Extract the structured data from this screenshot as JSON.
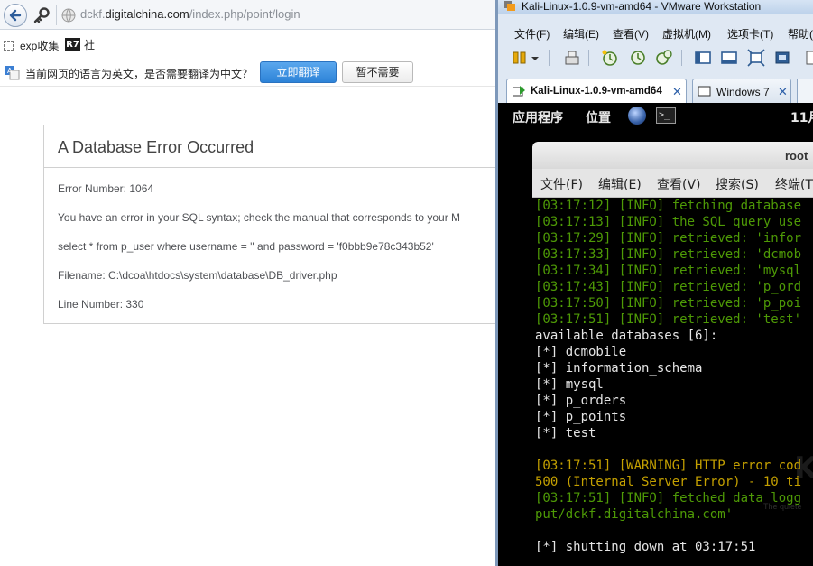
{
  "browser": {
    "url_prefix": "dckf.",
    "url_domain": "digitalchina.com",
    "url_path": "/index.php/point/login",
    "bookmarks": [
      {
        "label": "exp收集"
      },
      {
        "label": "社",
        "icon_text": "R7"
      }
    ],
    "translate_prompt": "当前网页的语言为英文，是否需要翻译为中文？",
    "translate_button": "立即翻译",
    "not_now_button": "暂不需要"
  },
  "error": {
    "title": "A Database Error Occurred",
    "lines": [
      "Error Number: 1064",
      "You have an error in your SQL syntax; check the manual that corresponds to your M",
      "select * from p_user where username = '' and password = 'f0bbb9e78c343b52'",
      "Filename: C:\\dcoa\\htdocs\\system\\database\\DB_driver.php",
      "Line Number: 330"
    ]
  },
  "vmware": {
    "window_title": "Kali-Linux-1.0.9-vm-amd64 - VMware Workstation",
    "menu": [
      "文件(F)",
      "编辑(E)",
      "查看(V)",
      "虚拟机(M)",
      "选项卡(T)",
      "帮助("
    ],
    "tabs": [
      {
        "label": "Kali-Linux-1.0.9-vm-amd64",
        "active": true
      },
      {
        "label": "Windows 7",
        "active": false
      }
    ]
  },
  "guest": {
    "panel": [
      "应用程序",
      "位置"
    ],
    "clock": "11月",
    "terminal": {
      "title": "root",
      "menu": [
        "文件(F)",
        "编辑(E)",
        "查看(V)",
        "搜索(S)",
        "终端(T"
      ],
      "lines": [
        {
          "text": "[03:17:12] [INFO] fetching database",
          "color": "#4e9a06"
        },
        {
          "text": "[03:17:13] [INFO] the SQL query use",
          "color": "#4e9a06"
        },
        {
          "text": "[03:17:29] [INFO] retrieved: 'infor",
          "color": "#4e9a06"
        },
        {
          "text": "[03:17:33] [INFO] retrieved: 'dcmob",
          "color": "#4e9a06"
        },
        {
          "text": "[03:17:34] [INFO] retrieved: 'mysql",
          "color": "#4e9a06"
        },
        {
          "text": "[03:17:43] [INFO] retrieved: 'p_ord",
          "color": "#4e9a06"
        },
        {
          "text": "[03:17:50] [INFO] retrieved: 'p_poi",
          "color": "#4e9a06"
        },
        {
          "text": "[03:17:51] [INFO] retrieved: 'test'",
          "color": "#4e9a06"
        },
        {
          "text": "available databases [6]:",
          "color": "#e5e5e5"
        },
        {
          "text": "[*] dcmobile",
          "color": "#e5e5e5"
        },
        {
          "text": "[*] information_schema",
          "color": "#e5e5e5"
        },
        {
          "text": "[*] mysql",
          "color": "#e5e5e5"
        },
        {
          "text": "[*] p_orders",
          "color": "#e5e5e5"
        },
        {
          "text": "[*] p_points",
          "color": "#e5e5e5"
        },
        {
          "text": "[*] test",
          "color": "#e5e5e5"
        },
        {
          "text": "",
          "color": "#e5e5e5"
        },
        {
          "text": "[03:17:51] [WARNING] HTTP error cod",
          "color": "#c4a000"
        },
        {
          "text": "500 (Internal Server Error) - 10 ti",
          "color": "#c4a000"
        },
        {
          "text": "[03:17:51] [INFO] fetched data logg",
          "color": "#4e9a06"
        },
        {
          "text": "put/dckf.digitalchina.com'",
          "color": "#4e9a06"
        },
        {
          "text": "",
          "color": "#e5e5e5"
        },
        {
          "text": "[*] shutting down at 03:17:51",
          "color": "#e5e5e5"
        }
      ],
      "watermark": "K",
      "tagline": "The quiete"
    }
  }
}
